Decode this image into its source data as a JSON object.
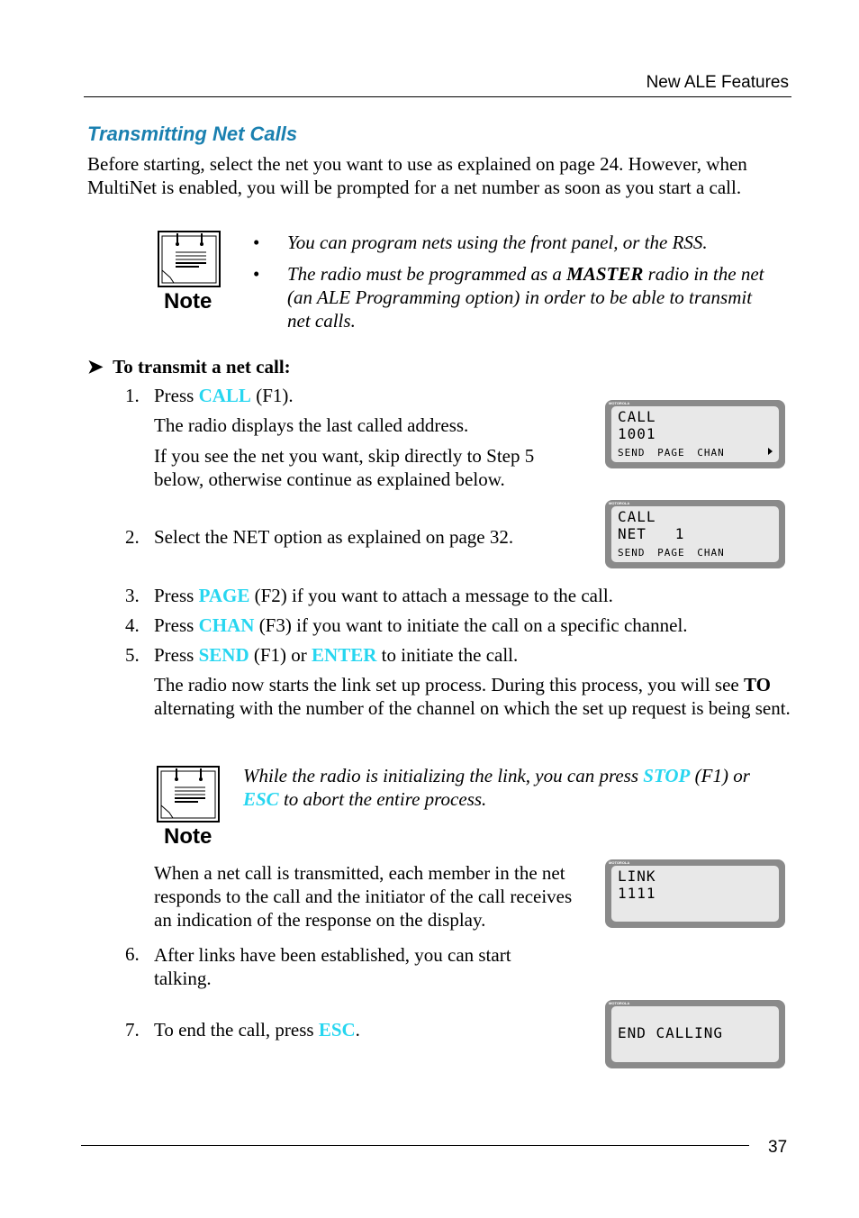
{
  "header": {
    "section": "New ALE Features"
  },
  "title": "Transmitting Net Calls",
  "intro": "Before starting, select the net you want to use as explained on page 24. However, when MultiNet is enabled, you will be prompted for a net number as soon as you start a call.",
  "note1": {
    "label": "Note",
    "bullets": [
      "You can program nets using the front panel, or the RSS.",
      {
        "pre": "The radio must be programmed as a ",
        "bold": "MASTER",
        "post": " radio in the net (an ALE Programming option) in order to be able to transmit net calls."
      }
    ]
  },
  "procedure": {
    "arrow": "➤",
    "heading": "To transmit a net call:"
  },
  "steps": {
    "s1": {
      "num": "1.",
      "pre": "Press ",
      "kw": "CALL",
      "post": " (F1).",
      "p1": "The radio displays the last called address.",
      "p2": "If you see the net you want, skip directly to Step 5 below, otherwise continue as explained below."
    },
    "s2": {
      "num": "2.",
      "text": "Select the NET option as explained on page 32."
    },
    "s3": {
      "num": "3.",
      "pre": "Press ",
      "kw": "PAGE",
      "post": " (F2) if you want to attach a message to the call."
    },
    "s4": {
      "num": "4.",
      "pre": "Press ",
      "kw": "CHAN",
      "post": " (F3) if you want to initiate the call on a specific channel."
    },
    "s5": {
      "num": "5.",
      "pre": "Press ",
      "kw": "SEND",
      "mid": " (F1) or ",
      "kw2": "ENTER",
      "post": " to initiate the call.",
      "p1a": "The radio now starts the link set up process. During this process, you will see ",
      "p1b": "TO",
      "p1c": " alternating with the number of the channel on which the set up request is being sent."
    },
    "s6": {
      "num": "6.",
      "text": "After links have been established, you can start talking."
    },
    "s7": {
      "num": "7.",
      "pre": "To end the call, press ",
      "kw": "ESC",
      "post": "."
    }
  },
  "note2": {
    "label": "Note",
    "pre": "While the radio is initializing the link, you can press ",
    "kw1": "STOP",
    "mid": " (F1) or ",
    "kw2": "ESC",
    "post": " to abort the entire process."
  },
  "net_response": "When a net call is transmitted, each member in the net responds to the call and the initiator of the call receives an indication of the response on the display.",
  "displays": [
    {
      "brand": "MOTOROLA",
      "line1": "CALL",
      "line2": "1001",
      "softkeys": "SEND PAGE CHAN"
    },
    {
      "brand": "MOTOROLA",
      "line1": "CALL",
      "line2": "NET   1",
      "softkeys": "SEND PAGE CHAN"
    },
    {
      "brand": "MOTOROLA",
      "line1": "LINK",
      "line2": "1111"
    },
    {
      "brand": "MOTOROLA",
      "line1": "END CALLING"
    }
  ],
  "footer": {
    "page": "37"
  }
}
